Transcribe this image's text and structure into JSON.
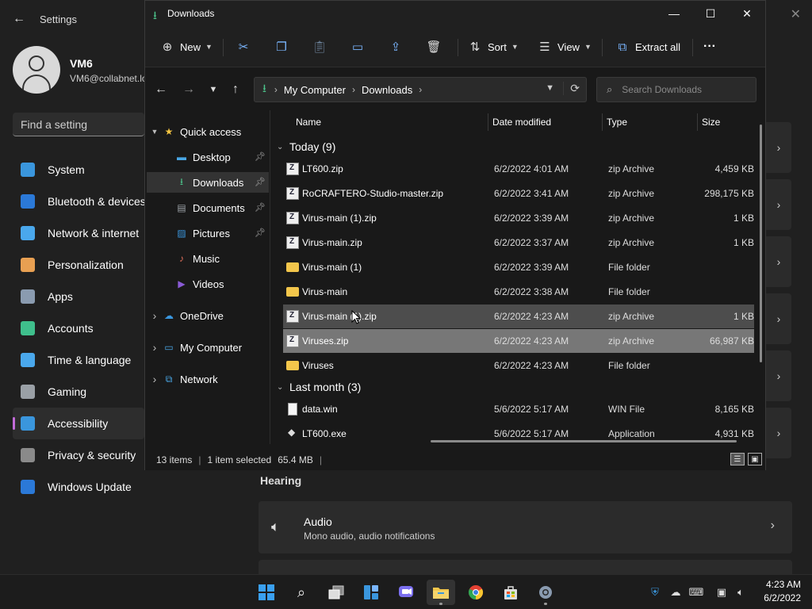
{
  "settings": {
    "title": "Settings",
    "user_name": "VM6",
    "user_email": "VM6@collabnet.lo",
    "search_placeholder": "Find a setting",
    "nav": [
      {
        "label": "System",
        "icon": "system-icon",
        "color": "#3a96dd"
      },
      {
        "label": "Bluetooth & devices",
        "icon": "bluetooth-icon",
        "color": "#2b79d8"
      },
      {
        "label": "Network & internet",
        "icon": "wifi-icon",
        "color": "#4aa8ec"
      },
      {
        "label": "Personalization",
        "icon": "brush-icon",
        "color": "#e8a052"
      },
      {
        "label": "Apps",
        "icon": "apps-icon",
        "color": "#8a9bb0"
      },
      {
        "label": "Accounts",
        "icon": "person-icon",
        "color": "#3fbf8c"
      },
      {
        "label": "Time & language",
        "icon": "clock-globe-icon",
        "color": "#4aa8ec"
      },
      {
        "label": "Gaming",
        "icon": "gamepad-icon",
        "color": "#9aa0a6"
      },
      {
        "label": "Accessibility",
        "icon": "accessibility-icon",
        "color": "#3a96dd"
      },
      {
        "label": "Privacy & security",
        "icon": "shield-icon",
        "color": "#8a8a8a"
      },
      {
        "label": "Windows Update",
        "icon": "update-icon",
        "color": "#2b79d8"
      }
    ],
    "active_nav": "Accessibility",
    "hearing_heading": "Hearing",
    "audio_card": {
      "title": "Audio",
      "subtitle": "Mono audio, audio notifications"
    }
  },
  "explorer": {
    "title": "Downloads",
    "toolbar": {
      "new_label": "New",
      "sort_label": "Sort",
      "view_label": "View",
      "extract_label": "Extract all"
    },
    "address": {
      "root": "My Computer",
      "folder": "Downloads"
    },
    "search_placeholder": "Search Downloads",
    "sidebar": [
      {
        "label": "Quick access",
        "icon": "star-icon",
        "color": "#f5c542",
        "expanded": true,
        "indent": 0,
        "pinned": false,
        "selected": false
      },
      {
        "label": "Desktop",
        "icon": "desktop-icon",
        "color": "#49a7e6",
        "indent": 1,
        "pinned": true,
        "selected": false
      },
      {
        "label": "Downloads",
        "icon": "download-icon",
        "color": "#4cc38a",
        "indent": 1,
        "pinned": true,
        "selected": true
      },
      {
        "label": "Documents",
        "icon": "document-icon",
        "color": "#9aa0a6",
        "indent": 1,
        "pinned": true,
        "selected": false
      },
      {
        "label": "Pictures",
        "icon": "pictures-icon",
        "color": "#3a96dd",
        "indent": 1,
        "pinned": true,
        "selected": false
      },
      {
        "label": "Music",
        "icon": "music-icon",
        "color": "#e06f5b",
        "indent": 1,
        "pinned": false,
        "selected": false
      },
      {
        "label": "Videos",
        "icon": "video-icon",
        "color": "#8a5bd6",
        "indent": 1,
        "pinned": false,
        "selected": false
      },
      {
        "label": "OneDrive",
        "icon": "cloud-icon",
        "color": "#3a96dd",
        "indent": 0,
        "pinned": false,
        "selected": false
      },
      {
        "label": "My Computer",
        "icon": "computer-icon",
        "color": "#49a7e6",
        "indent": 0,
        "pinned": false,
        "selected": false
      },
      {
        "label": "Network",
        "icon": "network-icon",
        "color": "#49a7e6",
        "indent": 0,
        "pinned": false,
        "selected": false
      }
    ],
    "columns": [
      "Name",
      "Date modified",
      "Type",
      "Size"
    ],
    "groups": [
      {
        "label": "Today (9)",
        "files": [
          {
            "name": "LT600.zip",
            "date": "6/2/2022 4:01 AM",
            "type": "zip Archive",
            "size": "4,459 KB",
            "kind": "zip",
            "state": ""
          },
          {
            "name": "RoCRAFTERO-Studio-master.zip",
            "date": "6/2/2022 3:41 AM",
            "type": "zip Archive",
            "size": "298,175 KB",
            "kind": "zip",
            "state": ""
          },
          {
            "name": "Virus-main (1).zip",
            "date": "6/2/2022 3:39 AM",
            "type": "zip Archive",
            "size": "1 KB",
            "kind": "zip",
            "state": ""
          },
          {
            "name": "Virus-main.zip",
            "date": "6/2/2022 3:37 AM",
            "type": "zip Archive",
            "size": "1 KB",
            "kind": "zip",
            "state": ""
          },
          {
            "name": "Virus-main (1)",
            "date": "6/2/2022 3:39 AM",
            "type": "File folder",
            "size": "",
            "kind": "folder",
            "state": ""
          },
          {
            "name": "Virus-main",
            "date": "6/2/2022 3:38 AM",
            "type": "File folder",
            "size": "",
            "kind": "folder",
            "state": ""
          },
          {
            "name": "Virus-main (1).zip",
            "date": "6/2/2022 4:23 AM",
            "type": "zip Archive",
            "size": "1 KB",
            "kind": "zip",
            "state": "hover"
          },
          {
            "name": "Viruses.zip",
            "date": "6/2/2022 4:23 AM",
            "type": "zip Archive",
            "size": "66,987 KB",
            "kind": "zip",
            "state": "selected"
          },
          {
            "name": "Viruses",
            "date": "6/2/2022 4:23 AM",
            "type": "File folder",
            "size": "",
            "kind": "folder",
            "state": ""
          }
        ]
      },
      {
        "label": "Last month (3)",
        "files": [
          {
            "name": "data.win",
            "date": "5/6/2022 5:17 AM",
            "type": "WIN File",
            "size": "8,165 KB",
            "kind": "file",
            "state": ""
          },
          {
            "name": "LT600.exe",
            "date": "5/6/2022 5:17 AM",
            "type": "Application",
            "size": "4,931 KB",
            "kind": "app",
            "state": ""
          }
        ]
      }
    ],
    "status": {
      "count": "13 items",
      "selection": "1 item selected",
      "size": "65.4 MB"
    }
  },
  "taskbar": {
    "apps": [
      "windows-start-icon",
      "search-icon",
      "task-view-icon",
      "widgets-icon",
      "chat-icon",
      "file-explorer-icon",
      "chrome-icon",
      "store-icon",
      "settings-icon"
    ],
    "time": "4:23 AM",
    "date": "6/2/2022"
  },
  "accent": "#7ab6ff"
}
